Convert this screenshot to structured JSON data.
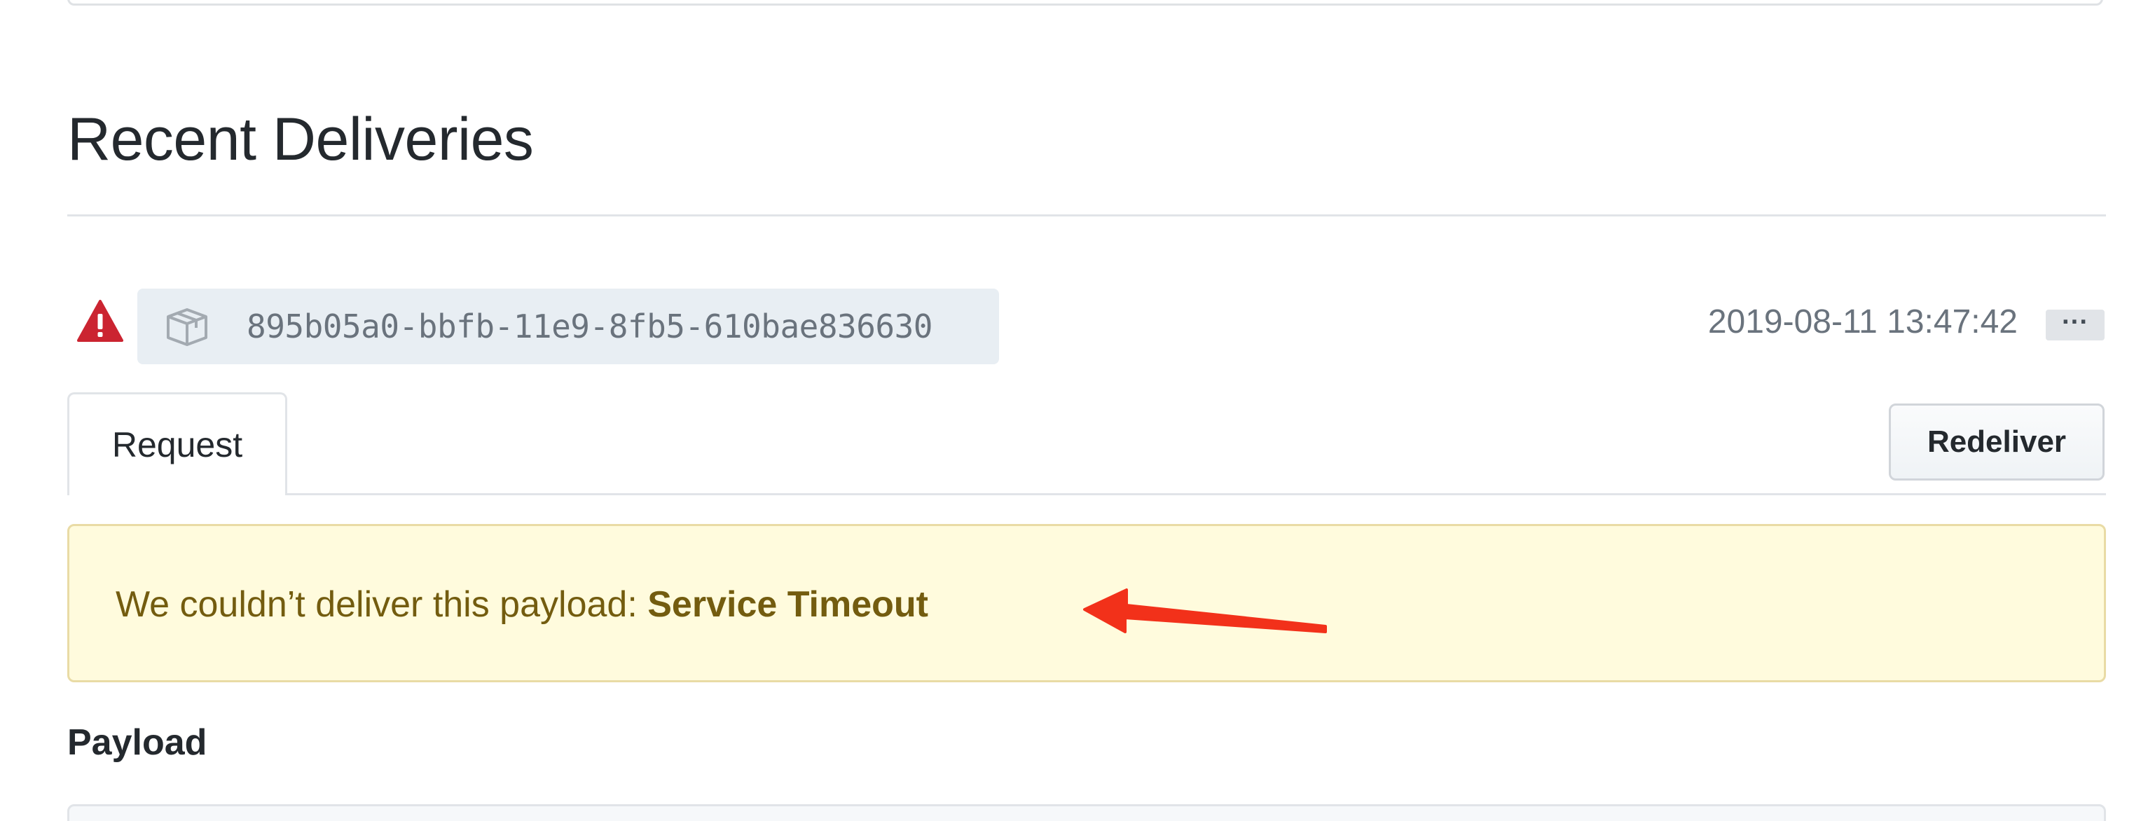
{
  "section": {
    "title": "Recent Deliveries"
  },
  "delivery": {
    "status_icon": "alert-icon",
    "package_icon": "package-icon",
    "guid": "895b05a0-bbfb-11e9-8fb5-610bae836630",
    "timestamp": "2019-08-11 13:47:42",
    "more_label": "···"
  },
  "tabs": [
    {
      "label": "Request"
    }
  ],
  "actions": {
    "redeliver_label": "Redeliver"
  },
  "flash": {
    "message_prefix": "We couldn’t deliver this payload: ",
    "message_reason": "Service Timeout",
    "annotation_icon": "red-arrow-icon"
  },
  "payload": {
    "title": "Payload"
  },
  "colors": {
    "warning_red": "#cb2431",
    "flash_bg": "#fffbdd",
    "flash_text": "#735c0f",
    "guid_bg": "#e8eef3",
    "arrow_red": "#f2311a"
  }
}
